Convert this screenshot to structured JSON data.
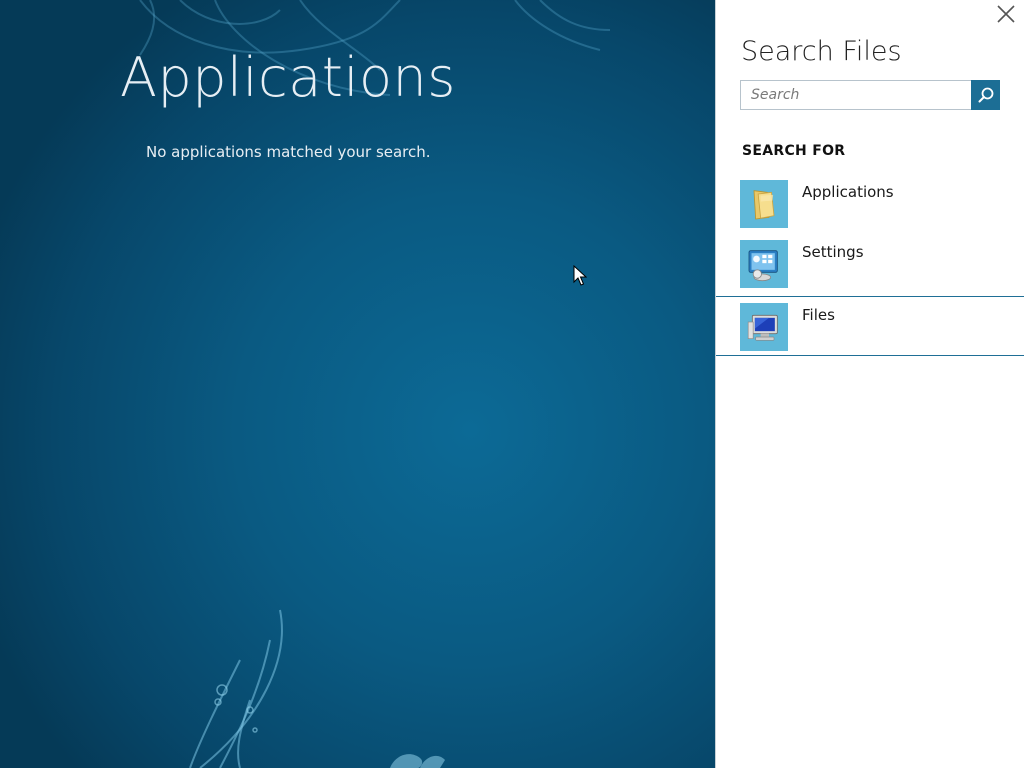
{
  "start_screen": {
    "title": "Applications",
    "message": "No applications matched your search."
  },
  "search_charm": {
    "title": "Search Files",
    "search_placeholder": "Search",
    "search_value": "",
    "section_label": "SEARCH FOR",
    "scopes": [
      {
        "label": "Applications",
        "icon": "folder-icon",
        "selected": false
      },
      {
        "label": "Settings",
        "icon": "control-panel-icon",
        "selected": false
      },
      {
        "label": "Files",
        "icon": "computer-icon",
        "selected": true
      }
    ]
  },
  "colors": {
    "background_accent": "#0a5a82",
    "charm_accent": "#1c6e95",
    "tile_icon_bg": "#5fb8d9"
  }
}
